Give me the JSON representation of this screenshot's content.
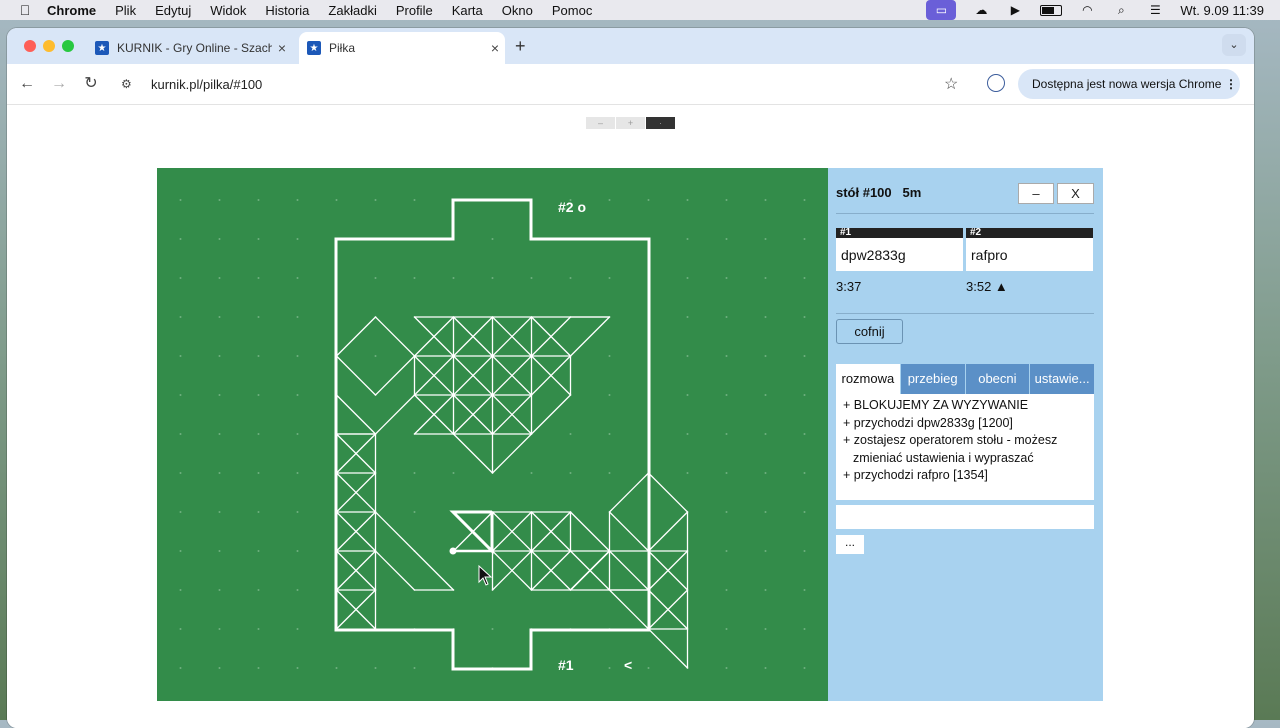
{
  "menubar": {
    "app": "Chrome",
    "items": [
      "Plik",
      "Edytuj",
      "Widok",
      "Historia",
      "Zakładki",
      "Profile",
      "Karta",
      "Okno",
      "Pomoc"
    ],
    "clock": "Wt. 9.09  11:39"
  },
  "browser": {
    "tabs": [
      {
        "label": "KURNIK - Gry Online - Szach"
      },
      {
        "label": "Piłka"
      }
    ],
    "url": "kurnik.pl/pilka/#100",
    "update_label": "Dostępna jest nowa wersja Chrome"
  },
  "zoom": {
    "minus": "–",
    "plus": "+",
    "selected": "·"
  },
  "board": {
    "label_top": "#2 o",
    "label_bottom": "#1",
    "turn_marker": "<"
  },
  "panel": {
    "table_label": "stół #100",
    "time_control": "5m",
    "minimize_label": "–",
    "close_label": "X",
    "players": [
      {
        "seat": "#1",
        "name": "dpw2833g",
        "time": "3:37"
      },
      {
        "seat": "#2",
        "name": "rafpro",
        "time": "3:52 ▲"
      }
    ],
    "undo_label": "cofnij",
    "tabs": [
      "rozmowa",
      "przebieg",
      "obecni",
      "ustawie..."
    ],
    "chat": [
      "+ BLOKUJEMY ZA WYZYWANIE",
      "+ przychodzi dpw2833g [1200]",
      "+ zostajesz operatorem stołu - możesz",
      "zmieniać ustawienia i wypraszać",
      "+ przychodzi rafpro [1354]"
    ],
    "more_label": "..."
  }
}
